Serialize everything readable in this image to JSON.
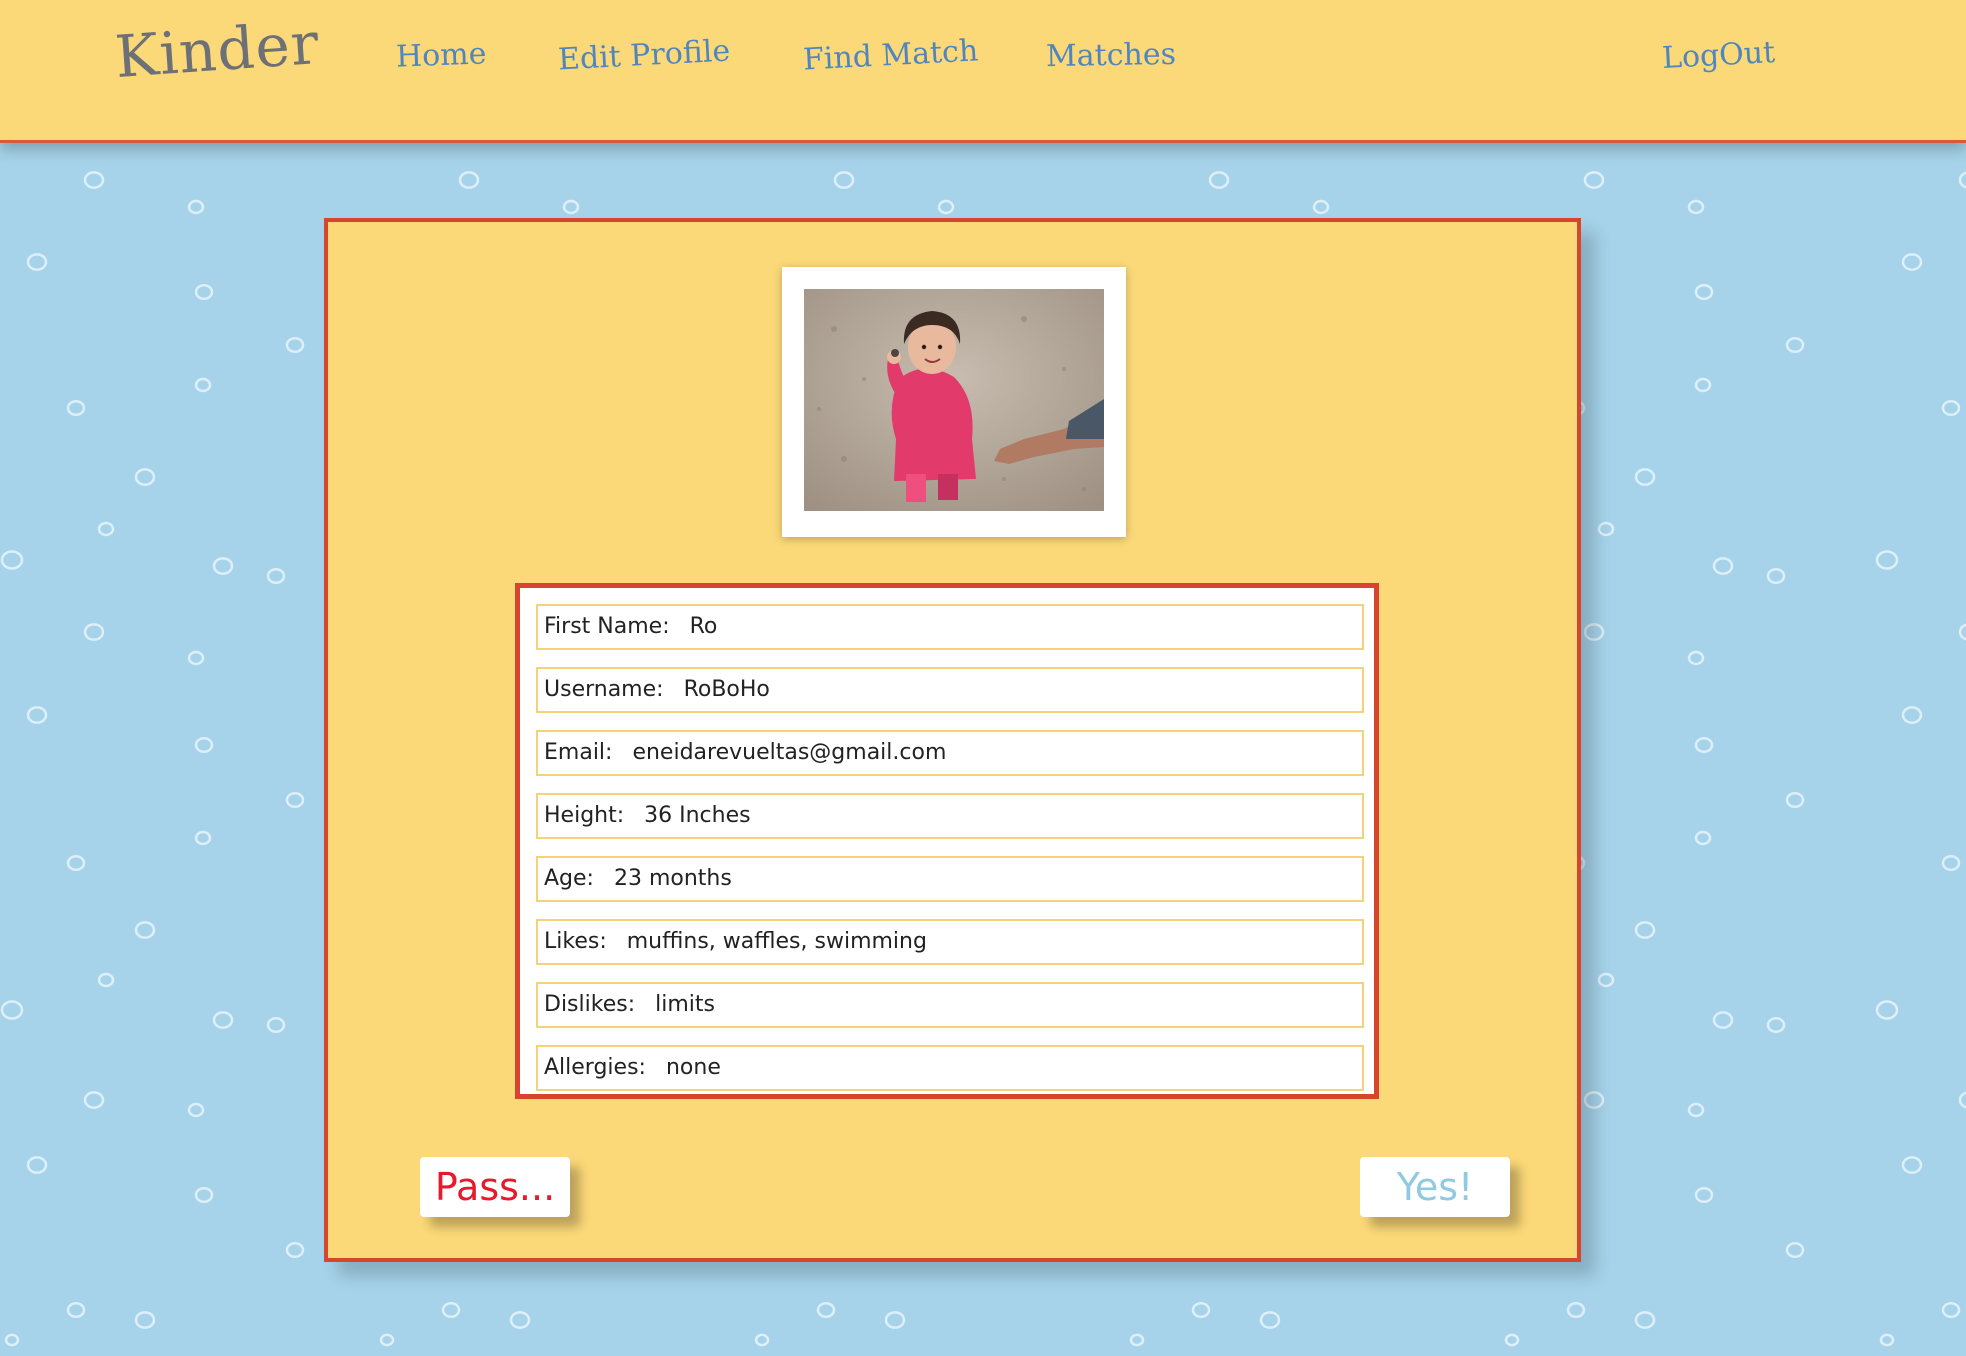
{
  "nav": {
    "brand": "Kinder",
    "home": "Home",
    "edit_profile": "Edit Profile",
    "find_match": "Find Match",
    "matches": "Matches",
    "logout": "LogOut"
  },
  "profile": {
    "fields": [
      {
        "label": "First Name:",
        "value": "Ro"
      },
      {
        "label": "Username:",
        "value": "RoBoHo"
      },
      {
        "label": "Email:",
        "value": "eneidarevueltas@gmail.com"
      },
      {
        "label": "Height:",
        "value": "36 Inches"
      },
      {
        "label": "Age:",
        "value": "23 months"
      },
      {
        "label": "Likes:",
        "value": "muffins, waffles, swimming"
      },
      {
        "label": "Dislikes:",
        "value": "limits"
      },
      {
        "label": "Allergies:",
        "value": "none"
      }
    ]
  },
  "actions": {
    "pass": "Pass...",
    "yes": "Yes!"
  },
  "colors": {
    "background": "#a6d3ea",
    "header": "#fbd878",
    "card": "#fbd878",
    "border_red": "#d8452e",
    "nav_link": "#4f86c0",
    "brand": "#6e7078",
    "pass": "#e8192c",
    "yes": "#8fc9e2"
  }
}
